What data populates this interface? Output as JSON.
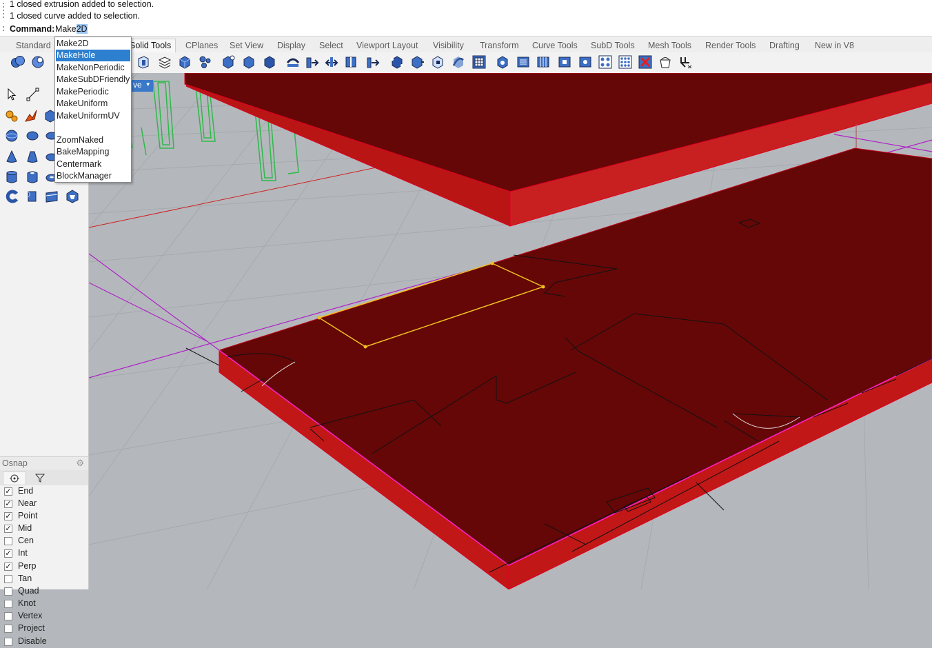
{
  "history": {
    "line1": "1 closed extrusion added to selection.",
    "line2": "1 closed curve added to selection."
  },
  "command": {
    "label": "Command:",
    "typed": "Make",
    "completion": "2D"
  },
  "tabs": [
    "Standard",
    "Solid Tools",
    "CPlanes",
    "Set View",
    "Display",
    "Select",
    "Viewport Layout",
    "Visibility",
    "Transform",
    "Curve Tools",
    "SubD Tools",
    "Mesh Tools",
    "Render Tools",
    "Drafting",
    "New in V8"
  ],
  "active_tab": "Solid Tools",
  "autocomplete": {
    "items": [
      "Make2D",
      "MakeHole",
      "MakeNonPeriodic",
      "MakeSubDFriendly",
      "MakePeriodic",
      "MakeUniform",
      "MakeUniformUV",
      "",
      "ZoomNaked",
      "BakeMapping",
      "Centermark",
      "BlockManager"
    ],
    "selected": "MakeHole"
  },
  "viewport": {
    "tab_label": "ve"
  },
  "osnap": {
    "title": "Osnap",
    "items": [
      {
        "label": "End",
        "checked": true
      },
      {
        "label": "Near",
        "checked": true
      },
      {
        "label": "Point",
        "checked": true
      },
      {
        "label": "Mid",
        "checked": true
      },
      {
        "label": "Cen",
        "checked": false
      },
      {
        "label": "Int",
        "checked": true
      },
      {
        "label": "Perp",
        "checked": true
      },
      {
        "label": "Tan",
        "checked": false
      },
      {
        "label": "Quad",
        "checked": false
      },
      {
        "label": "Knot",
        "checked": false
      },
      {
        "label": "Vertex",
        "checked": false
      },
      {
        "label": "Project",
        "checked": false
      },
      {
        "label": "Disable",
        "checked": false
      }
    ]
  },
  "colors": {
    "solid_fill": "#650707",
    "solid_edge": "#c2001a",
    "selected_curve": "#f0c020",
    "cplane_axis": "#b020c8"
  }
}
